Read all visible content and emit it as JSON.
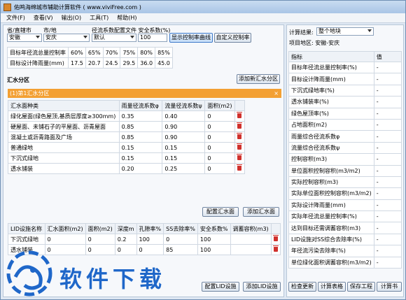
{
  "window": {
    "title": "佑鸣海绵城市辅助计算软件 ( www.viviFree.com )"
  },
  "menu": [
    "文件(F)",
    "查看(V)",
    "输出(O)",
    "工具(T)",
    "帮助(H)"
  ],
  "header": {
    "province_label": "省/直辖市",
    "city_label": "市/地",
    "config_label": "径流系数配置文件 安全系数(%)",
    "province": "安徽",
    "city": "安庆",
    "config": "默认",
    "safety": "100",
    "btn_curve": "显示控制率曲线",
    "btn_custom": "自定义控制率"
  },
  "rates": {
    "row1_label": "目标年径流总量控制率",
    "row1": [
      "60%",
      "65%",
      "70%",
      "75%",
      "80%",
      "85%"
    ],
    "row2_label": "目标设计降雨量(mm)",
    "row2": [
      "17.5",
      "20.7",
      "24.5",
      "29.5",
      "36.0",
      "45.0"
    ]
  },
  "zone": {
    "section_label": "汇水分区",
    "add_zone_btn": "添加新汇水分区",
    "tab_label": "(1)第1汇水分区",
    "close_glyph": "×",
    "columns": [
      "汇水面种类",
      "雨量径流系数φ",
      "流量径流系数ψ",
      "面积(m2)",
      ""
    ],
    "rows": [
      [
        "绿化屋面(绿色屋顶,基质层厚度≥300mm)",
        "0.35",
        "0.40",
        "0"
      ],
      [
        "硬屋面、未铺石子的平屋面、沥青屋面",
        "0.85",
        "0.90",
        "0"
      ],
      [
        "混凝土或沥青路面及广场",
        "0.85",
        "0.90",
        "0"
      ],
      [
        "普通绿地",
        "0.15",
        "0.15",
        "0"
      ],
      [
        "下沉式绿地",
        "0.15",
        "0.15",
        "0"
      ],
      [
        "透水铺装",
        "0.20",
        "0.25",
        "0"
      ]
    ],
    "config_btn": "配置汇水面",
    "add_btn": "添加汇水面"
  },
  "lid": {
    "columns": [
      "LID设施名称",
      "汇水面积(m2)",
      "面积(m2)",
      "深度m",
      "孔隙率%",
      "SS去除率%",
      "安全系数%",
      "调蓄容积(m3)",
      ""
    ],
    "rows": [
      [
        "下沉式绿地",
        "0",
        "0",
        "0.2",
        "100",
        "0",
        "100",
        "",
        ""
      ],
      [
        "透水铺装",
        "0",
        "0",
        "0",
        "0",
        "85",
        "100",
        "",
        ""
      ]
    ],
    "config_btn": "配置LID设施",
    "add_btn": "添加LID设施"
  },
  "right": {
    "result_label": "计算结果:",
    "result_select": "整个地块",
    "area_label": "项目地区: 安徽-安庆",
    "table_header": [
      "指标",
      "值"
    ],
    "metrics": [
      "目标年径流总量控制率(%)",
      "目标设计降雨量(mm)",
      "下沉式绿地率(%)",
      "透水铺装率(%)",
      "绿色屋顶率(%)",
      "占地面积(m2)",
      "雨量综合径流系数φ",
      "流量综合径流系数ψ",
      "控制容积(m3)",
      "单位面积控制容积(m3/m2)",
      "实际控制容积(m3)",
      "实际单位面积控制容积(m3/m2)",
      "实际设计降雨量(mm)",
      "实际年径流总量控制率(%)",
      "达到目标还需调蓄容积(m3)",
      "LID设施对SS综合去除率(%)",
      "年径流污染去除率(%)",
      "单位绿化面积调蓄容积(m3/m2)"
    ],
    "value": "-",
    "buttons": [
      "检查更新",
      "计算表格",
      "保存工程",
      "计算书"
    ]
  },
  "watermark": {
    "text": "软件下载"
  }
}
